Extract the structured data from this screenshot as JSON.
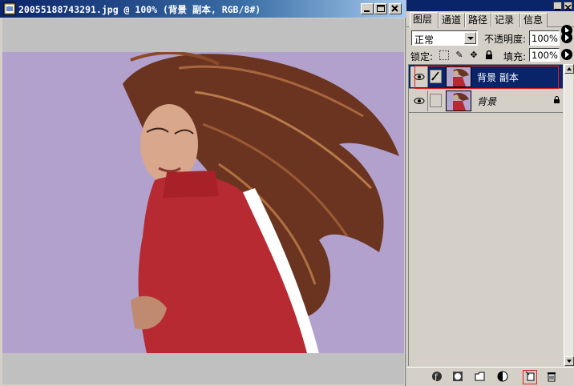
{
  "document": {
    "title": "20055188743291.jpg @ 100% (背景 副本, RGB/8#)",
    "image_alt": "photo of woman in red turtleneck with windblown hair",
    "colors": {
      "background": "#b6a6cf",
      "sweater": "#b82a32",
      "hair": "#6b3420"
    }
  },
  "window_controls": {
    "minimize": "minimize-icon",
    "maximize": "maximize-icon",
    "close": "close-icon"
  },
  "layers_panel": {
    "tabs": [
      {
        "label": "图层",
        "active": true
      },
      {
        "label": "通道",
        "active": false
      },
      {
        "label": "路径",
        "active": false
      },
      {
        "label": "记录",
        "active": false
      },
      {
        "label": "信息",
        "active": false
      }
    ],
    "blend_mode": "正常",
    "opacity_label": "不透明度:",
    "opacity_value": "100%",
    "lock_label": "锁定:",
    "fill_label": "填充:",
    "fill_value": "100%",
    "layers": [
      {
        "name": "背景 副本",
        "selected": true,
        "locked": false
      },
      {
        "name": "背景",
        "selected": false,
        "locked": true
      }
    ],
    "bottom_icons": [
      "layer-style-icon",
      "mask-icon",
      "group-folder-icon",
      "adjustment-layer-icon",
      "new-layer-icon",
      "trash-icon"
    ]
  }
}
